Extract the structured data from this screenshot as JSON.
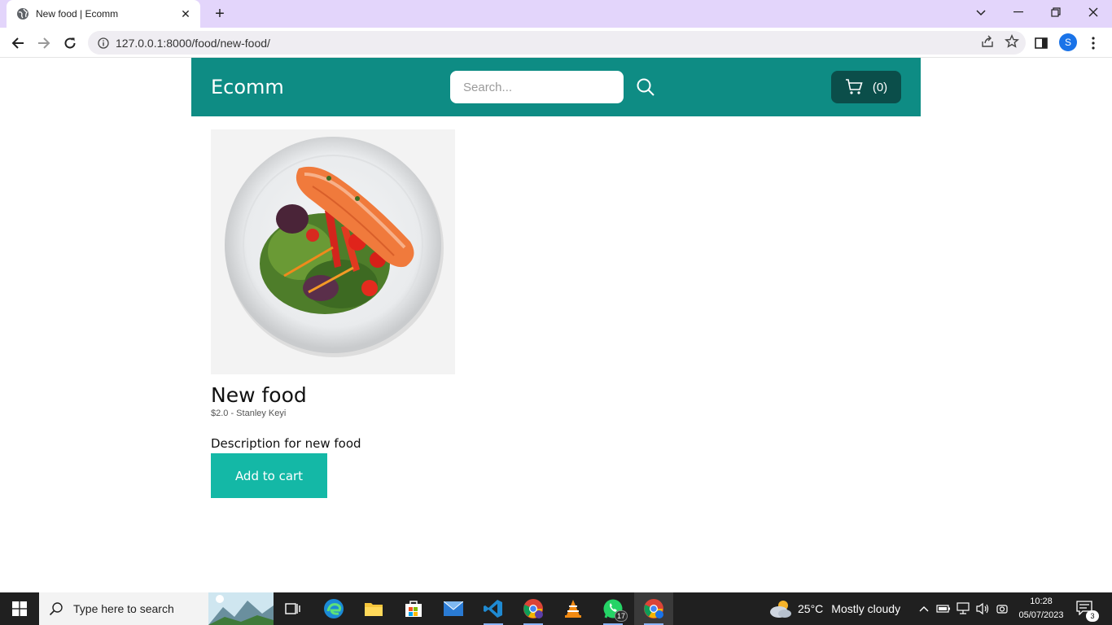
{
  "browser": {
    "tab_title": "New food | Ecomm",
    "url": "127.0.0.1:8000/food/new-food/",
    "profile_initial": "S"
  },
  "site": {
    "brand": "Ecomm",
    "search_placeholder": "Search...",
    "cart_count": "(0)"
  },
  "product": {
    "name": "New food",
    "meta": "$2.0 - Stanley Keyi",
    "description": "Description for new food",
    "add_to_cart_label": "Add to cart"
  },
  "taskbar": {
    "search_placeholder": "Type here to search",
    "whatsapp_badge": "17",
    "weather_temp": "25°C",
    "weather_text": "Mostly cloudy",
    "time": "10:28",
    "date": "05/07/2023",
    "notifications": "3"
  },
  "colors": {
    "navbar": "#0e8c84",
    "cart_button": "#0b4e4a",
    "add_to_cart": "#14b8a6",
    "tabstrip": "#e3d5fb"
  }
}
